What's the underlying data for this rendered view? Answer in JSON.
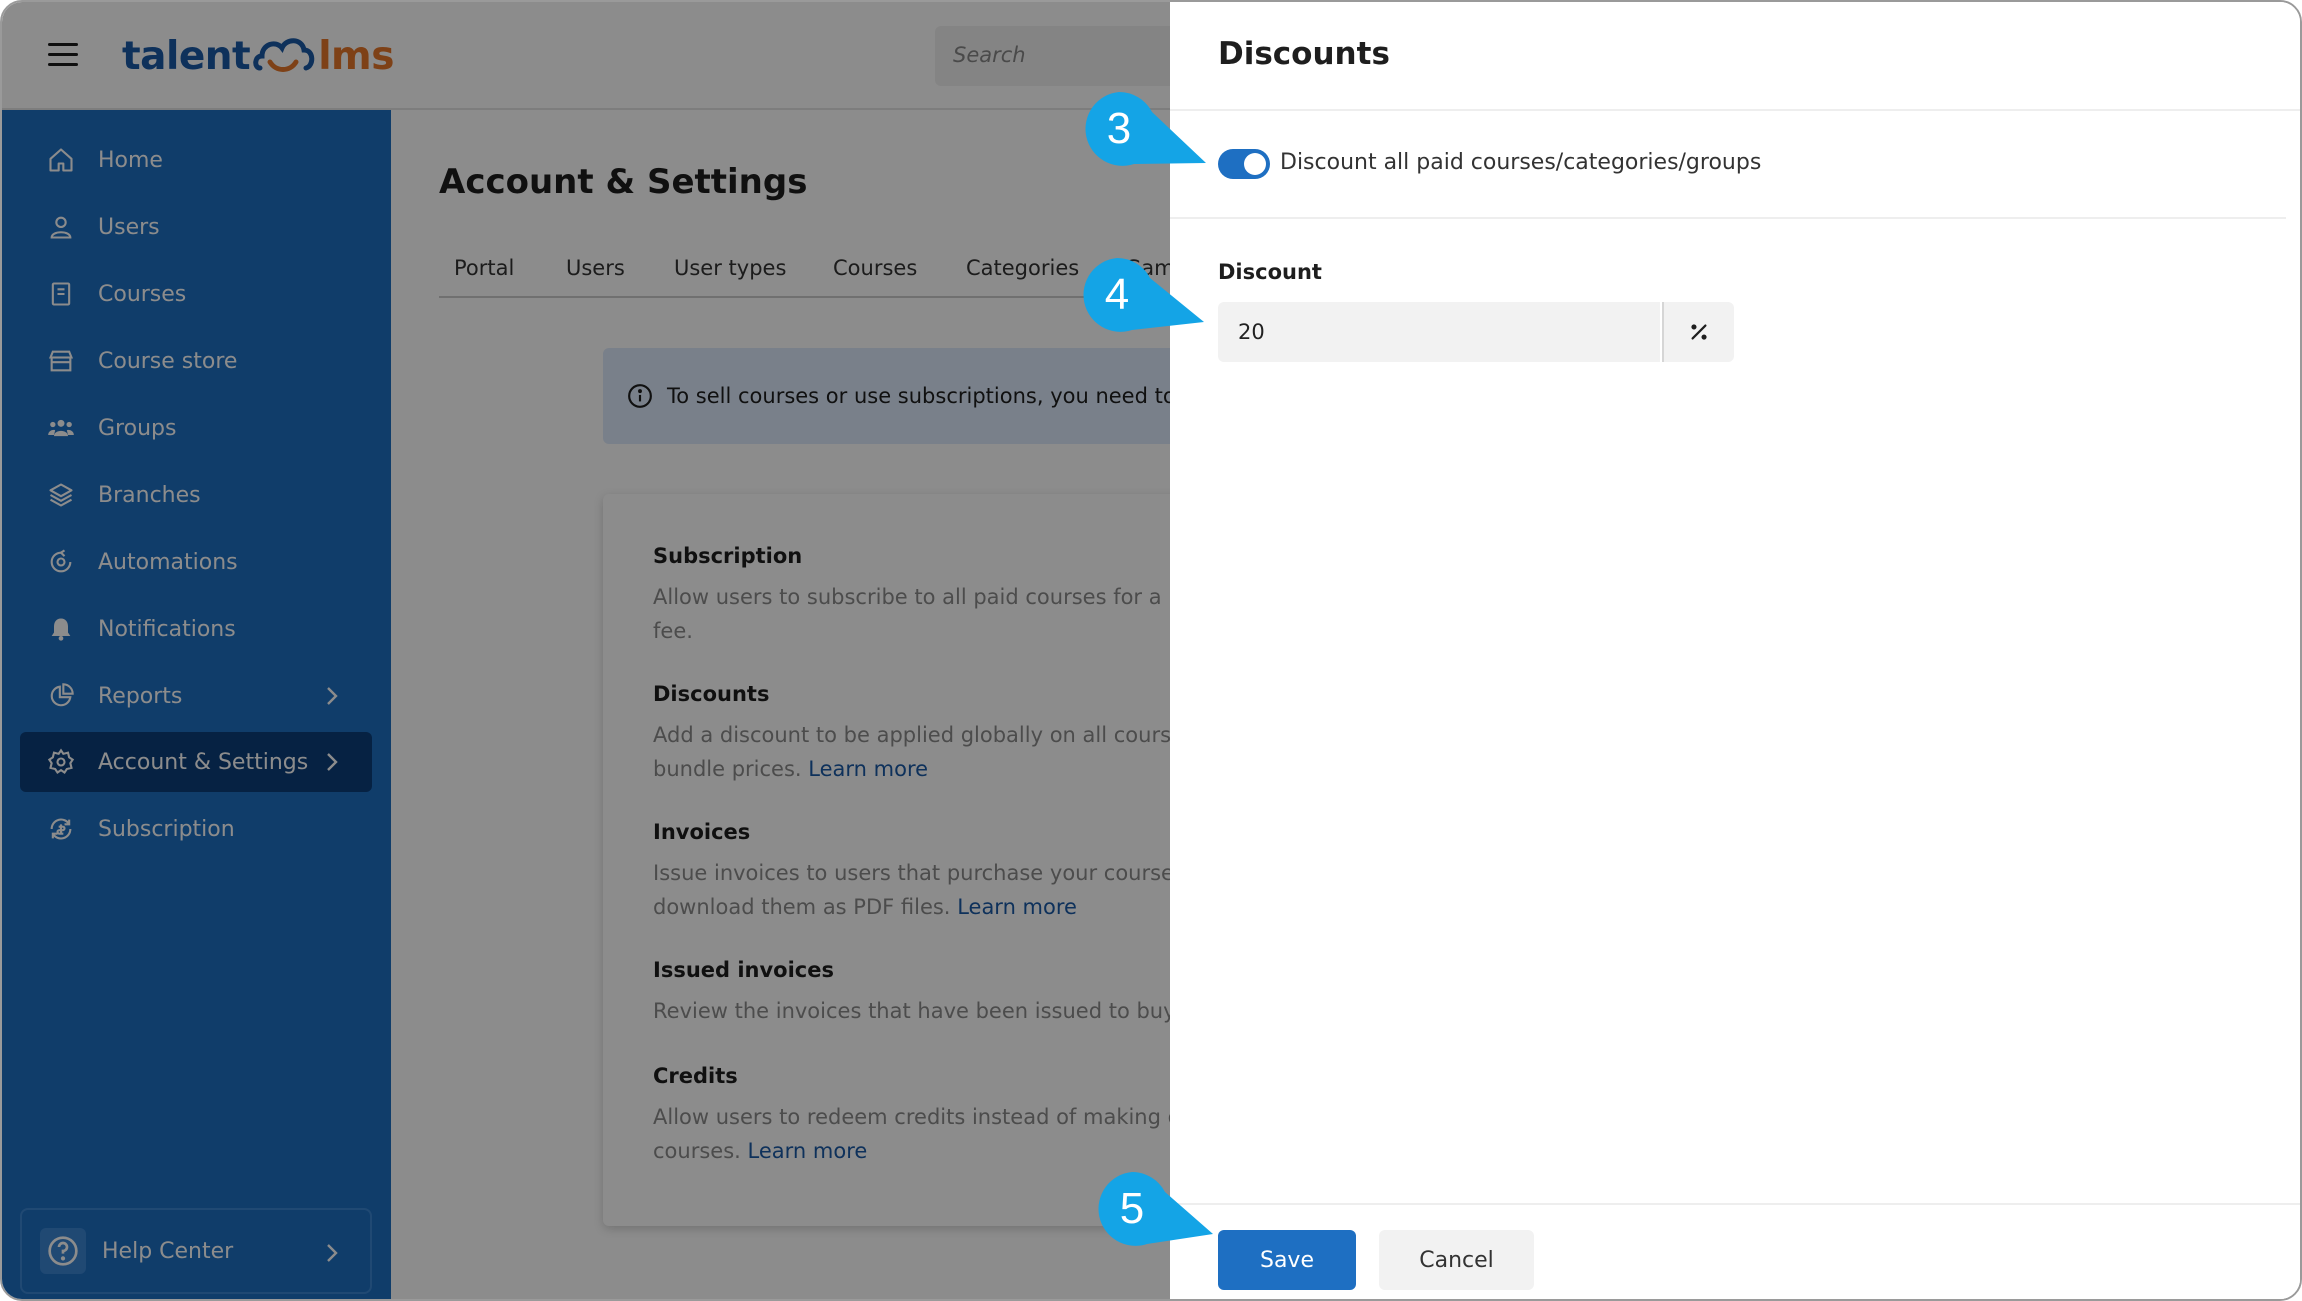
{
  "app": {
    "logo_left": "talent",
    "logo_right": "lms",
    "search_placeholder": "Search",
    "brand_color": "#1e6fc2",
    "accent_color": "#e5772a"
  },
  "sidebar": {
    "items": [
      {
        "label": "Home",
        "icon": "home-icon"
      },
      {
        "label": "Users",
        "icon": "user-icon"
      },
      {
        "label": "Courses",
        "icon": "book-icon"
      },
      {
        "label": "Course store",
        "icon": "store-icon"
      },
      {
        "label": "Groups",
        "icon": "groups-icon"
      },
      {
        "label": "Branches",
        "icon": "layers-icon"
      },
      {
        "label": "Automations",
        "icon": "automation-icon"
      },
      {
        "label": "Notifications",
        "icon": "bell-icon"
      },
      {
        "label": "Reports",
        "icon": "pie-chart-icon"
      },
      {
        "label": "Account & Settings",
        "icon": "gear-icon"
      },
      {
        "label": "Subscription",
        "icon": "subscription-icon"
      }
    ],
    "help_label": "Help Center"
  },
  "main": {
    "title": "Account & Settings",
    "tabs": [
      "Portal",
      "Users",
      "User types",
      "Courses",
      "Categories",
      "Gam"
    ],
    "info_text": "To sell courses or use subscriptions, you need to se",
    "sections": [
      {
        "title": "Subscription",
        "line1": "Allow users to subscribe to all paid courses for a mo",
        "line2": "fee.",
        "link": ""
      },
      {
        "title": "Discounts",
        "line1": "Add a discount to be applied globally on all course a",
        "line2": "bundle prices.",
        "link": "Learn more"
      },
      {
        "title": "Invoices",
        "line1": "Issue invoices to users that purchase your courses. U",
        "line2": "download them as PDF files.",
        "link": "Learn more"
      },
      {
        "title": "Issued invoices",
        "line1": "Review the invoices that have been issued to buyers",
        "line2": "",
        "link": ""
      },
      {
        "title": "Credits",
        "line1": "Allow users to redeem credits instead of making dire",
        "line2": "courses.",
        "link": "Learn more"
      }
    ]
  },
  "drawer": {
    "title": "Discounts",
    "toggle_label": "Discount all paid courses/categories/groups",
    "toggle_on": true,
    "discount_label": "Discount",
    "discount_value": "20",
    "unit_symbol": "%",
    "save_label": "Save",
    "cancel_label": "Cancel"
  },
  "callouts": {
    "step3": "3",
    "step4": "4",
    "step5": "5",
    "color": "#14a4e6"
  }
}
